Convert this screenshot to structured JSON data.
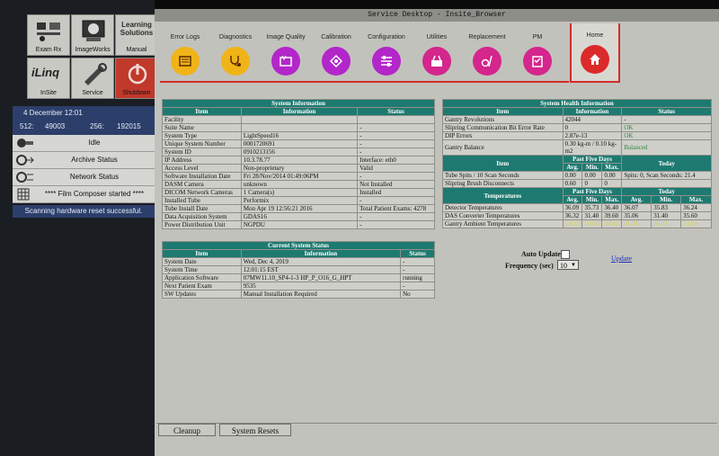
{
  "left_panel": {
    "buttons": [
      {
        "id": "exam-rx",
        "label": "Exam Rx"
      },
      {
        "id": "imageworks",
        "label": "ImageWorks"
      },
      {
        "id": "manual",
        "label": "Manual",
        "logo_text": "Learning Solutions"
      },
      {
        "id": "insite",
        "label": "InSite",
        "logo_text": "iLinq"
      },
      {
        "id": "service",
        "label": "Service"
      },
      {
        "id": "shutdown",
        "label": "Shutdown"
      }
    ],
    "date": "4 December 12:01",
    "stats": {
      "k1": "512:",
      "v1": "49003",
      "k2": "256:",
      "v2": "192015"
    },
    "status_rows": [
      "Idle",
      "Archive Status",
      "Network Status",
      "**** Film Composer started ****"
    ],
    "message": "Scanning hardware reset successful."
  },
  "window": {
    "title": "Service Desktop - Insite_Browser",
    "tabs": [
      {
        "label": "Error Logs",
        "color": "#f0b418",
        "icon": "error-logs-icon"
      },
      {
        "label": "Diagnostics",
        "color": "#f0b418",
        "icon": "stethoscope-icon"
      },
      {
        "label": "Image Quality",
        "color": "#b326c9",
        "icon": "image-quality-icon"
      },
      {
        "label": "Calibration",
        "color": "#b326c9",
        "icon": "calibration-icon"
      },
      {
        "label": "Configuration",
        "color": "#b326c9",
        "icon": "configuration-icon"
      },
      {
        "label": "Utilities",
        "color": "#d4268c",
        "icon": "utilities-icon"
      },
      {
        "label": "Replacement",
        "color": "#d4268c",
        "icon": "replacement-icon"
      },
      {
        "label": "PM",
        "color": "#d4268c",
        "icon": "pm-icon"
      },
      {
        "label": "Home",
        "color": "#dc2a2a",
        "icon": "home-icon"
      }
    ],
    "system_info": {
      "caption": "System Information",
      "headers": [
        "Item",
        "Information",
        "Status"
      ],
      "rows": [
        [
          "Facility",
          "",
          ""
        ],
        [
          "Suite Name",
          "",
          "-"
        ],
        [
          "System Type",
          "LightSpeed16",
          "-"
        ],
        [
          "Unique System Number",
          "0001720691",
          "-"
        ],
        [
          "System ID",
          "0910213156",
          "-"
        ],
        [
          "IP Address",
          "10.3.78.77",
          "Interface: eth0"
        ],
        [
          "Access Level",
          "Non-proprietary",
          "Valid"
        ],
        [
          "Software Installation Date",
          "Fri 28/Nov/2014 01:49:06PM",
          "-"
        ],
        [
          "DASM Camera",
          "unknown",
          "Not Installed"
        ],
        [
          "DICOM Network Cameras",
          "1 Camera(s)",
          "Installed"
        ],
        [
          "Installed Tube",
          "Performix",
          "-"
        ],
        [
          "Tube Install Date",
          "Mon Apr 19 12:56:21 2016",
          "Total Patient Exams: 4278"
        ],
        [
          "Data Acquisition System",
          "GDAS16",
          "-"
        ],
        [
          "Power Distribution Unit",
          "NGPDU",
          "-"
        ]
      ]
    },
    "current_status": {
      "caption": "Current System Status",
      "headers": [
        "Item",
        "Information",
        "Status"
      ],
      "rows": [
        [
          "System Date",
          "Wed, Dec 4, 2019",
          "-"
        ],
        [
          "System Time",
          "12:01:15 EST",
          "-"
        ],
        [
          "Application Software",
          "07MW11.10_SP4-1-3 HP_P_O16_G_HPT",
          "running"
        ],
        [
          "Next Patient Exam",
          "9535",
          "-"
        ],
        [
          "SW Updates",
          "Manual Installation Required",
          "No"
        ]
      ]
    },
    "health": {
      "caption": "System Health Information",
      "headers": [
        "Item",
        "Information",
        "Status"
      ],
      "rows": [
        [
          "Gantry Revolutions",
          "42044",
          "-"
        ],
        [
          "Slipring Communication Bit Error Rate",
          "0",
          "OK"
        ],
        [
          "DIP Errors",
          "2.87e-13",
          "OK"
        ],
        [
          "Gantry Balance",
          "0.30 kg-m / 0.10 kg-m2",
          "Balanced"
        ]
      ],
      "section2": {
        "item_label": "Item",
        "past_label": "Past Five Days",
        "today_label": "Today",
        "sub_headers": [
          "Avg.",
          "Min.",
          "Max."
        ],
        "rows": [
          [
            "Tube Spits / 10 Scan Seconds",
            "0.00",
            "0.00",
            "0.00",
            "Spits: 0, Scan Seconds: 21.4"
          ],
          [
            "Slipring Brush Disconnects",
            "0.60",
            "0",
            "0",
            ""
          ]
        ]
      },
      "section3": {
        "item_label": "Temperatures",
        "past_label": "Past Five Days",
        "today_label": "Today",
        "sub_headers": [
          "Avg.",
          "Min.",
          "Max.",
          "Avg.",
          "Min.",
          "Max."
        ],
        "rows": [
          [
            "Detector Temperatures",
            "36.09",
            "35.73",
            "36.40",
            "36.07",
            "35.83",
            "36.24"
          ],
          [
            "DAS Converter Temperatures",
            "36.32",
            "31.40",
            "39.60",
            "35.06",
            "31.40",
            "35.60"
          ],
          [
            "Gantry Ambient Temperatures",
            "32.22",
            "30.64",
            "38.47",
            "31.34",
            "30.38",
            "33.15"
          ]
        ]
      }
    },
    "auto_update_label": "Auto Update",
    "frequency_label": "Frequency (sec)",
    "frequency_value": "10",
    "update_link": "Update",
    "bottom_buttons": [
      "Cleanup",
      "System Resets"
    ]
  }
}
